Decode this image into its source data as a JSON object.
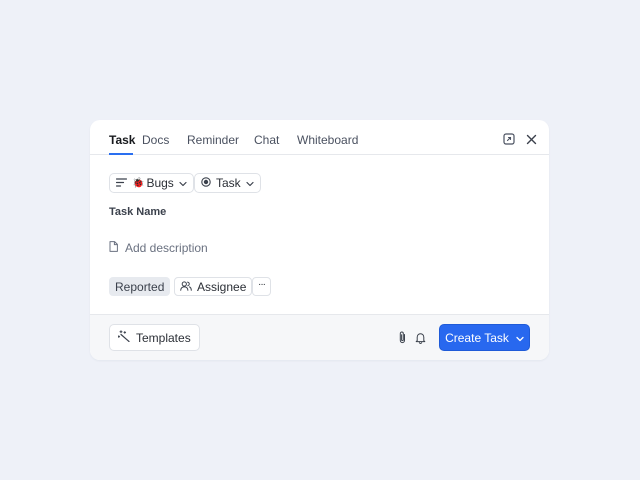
{
  "tabs": [
    {
      "label": "Task",
      "active": true
    },
    {
      "label": "Docs",
      "active": false
    },
    {
      "label": "Reminder",
      "active": false
    },
    {
      "label": "Chat",
      "active": false
    },
    {
      "label": "Whiteboard",
      "active": false
    }
  ],
  "header_icons": [
    "expand-icon",
    "close-icon"
  ],
  "selectors": {
    "list": {
      "label": "Bugs",
      "emoji": "🐞"
    },
    "type": {
      "label": "Task"
    }
  },
  "task_name_placeholder": "Task Name",
  "description_placeholder": "Add description",
  "fields": {
    "status": "Reported",
    "assignee": "Assignee",
    "more": "···"
  },
  "footer": {
    "templates_label": "Templates",
    "create_label": "Create Task"
  },
  "colors": {
    "accent": "#2868ef",
    "background": "#eef1f8"
  }
}
